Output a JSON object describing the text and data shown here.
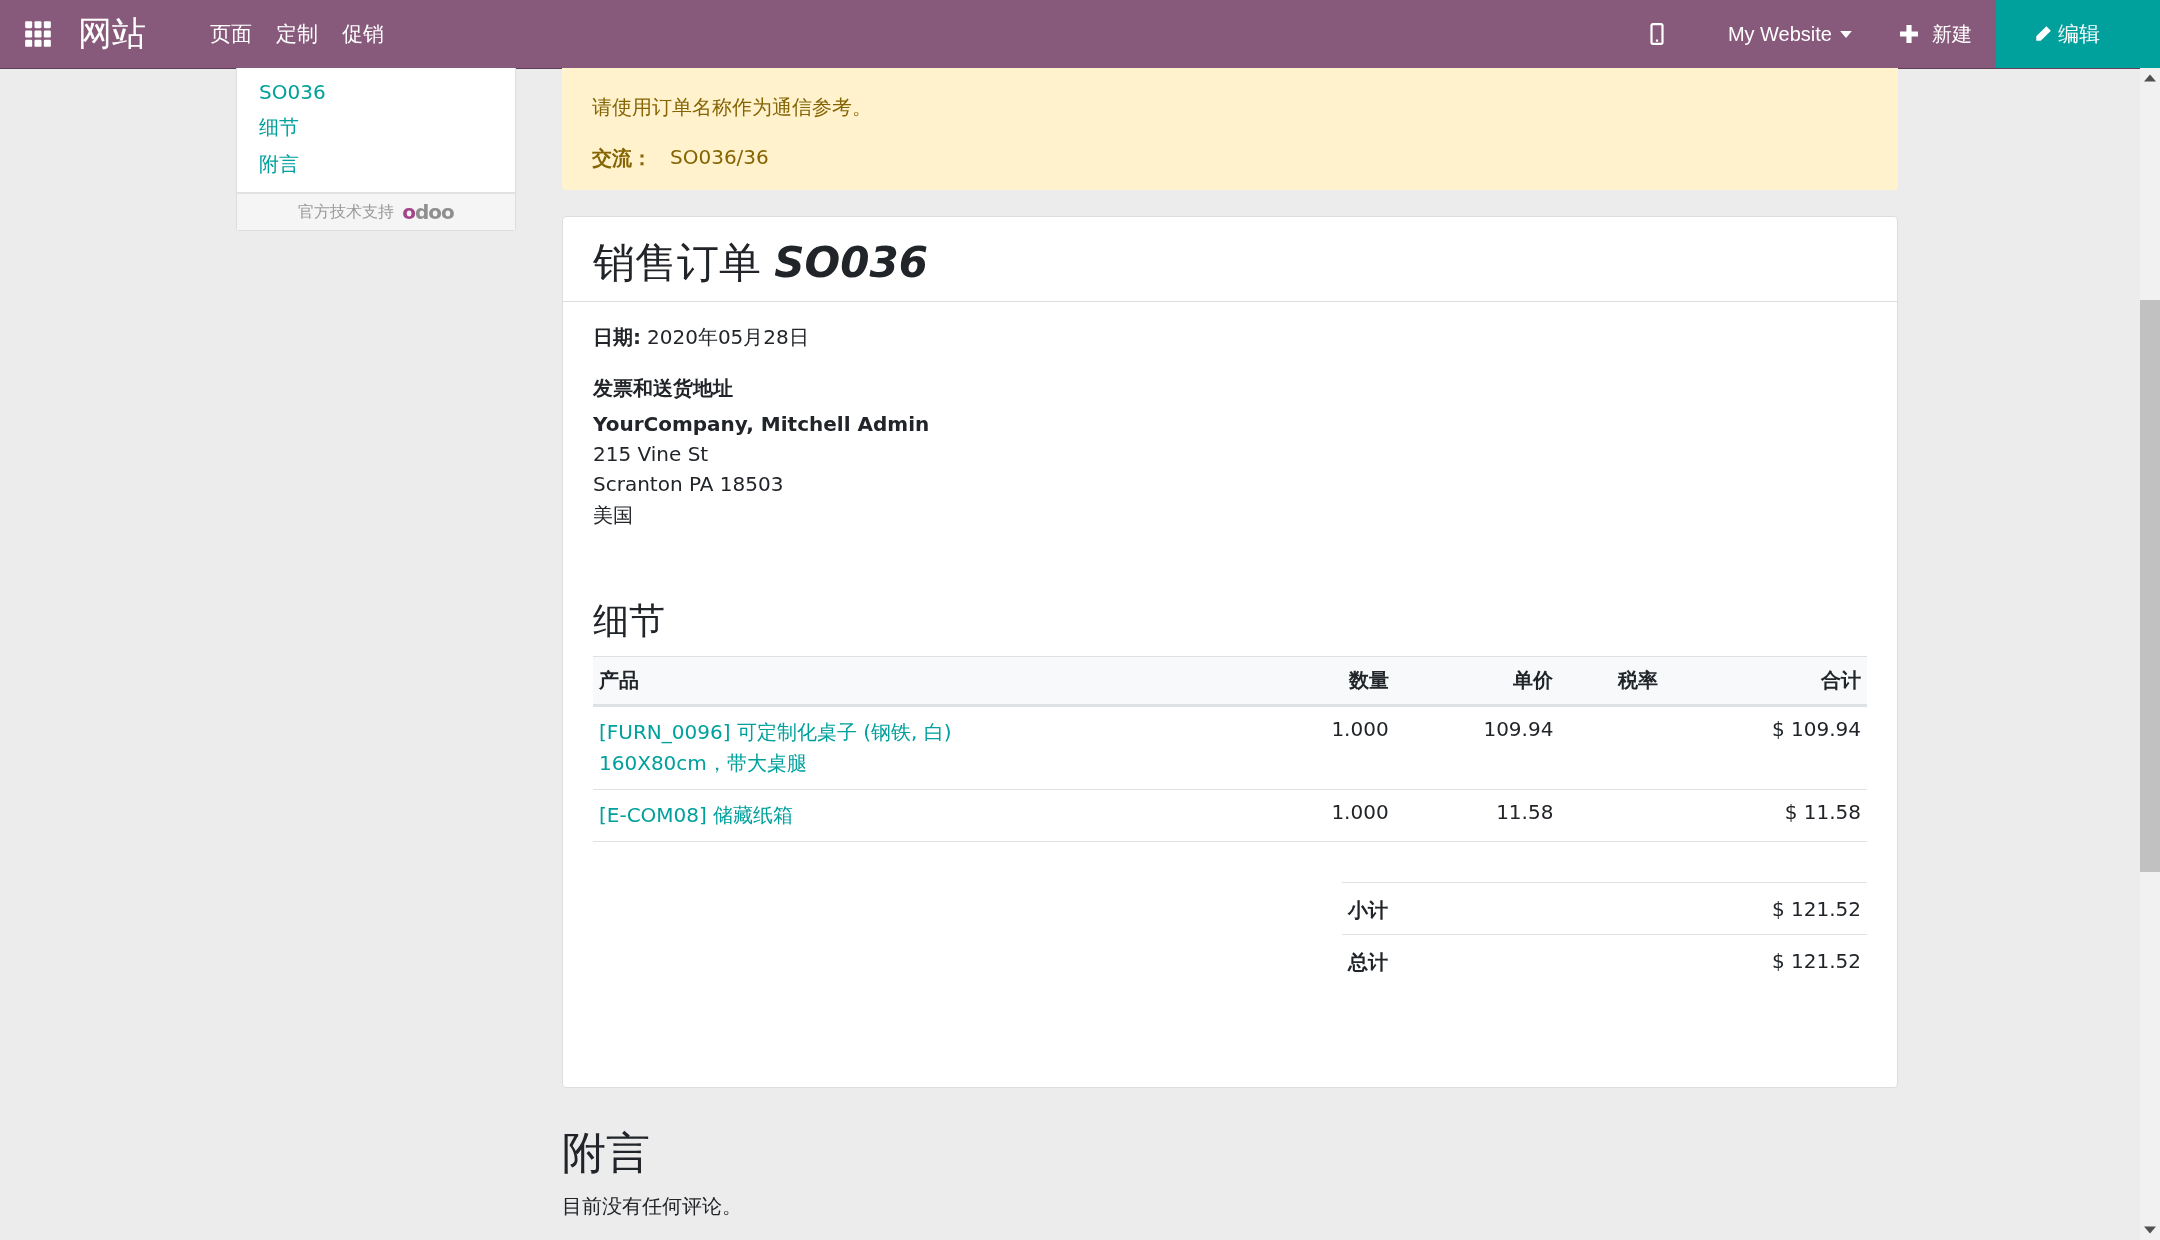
{
  "navbar": {
    "app_title": "网站",
    "menu": [
      {
        "label": "页面"
      },
      {
        "label": "定制"
      },
      {
        "label": "促销"
      }
    ],
    "website": "My Website",
    "new_button": "新建",
    "edit_button": "编辑"
  },
  "sidebar": {
    "items": [
      {
        "label": "SO036"
      },
      {
        "label": "细节"
      },
      {
        "label": "附言"
      }
    ],
    "footer": "官方技术支持",
    "footer_logo": "odoo"
  },
  "alert": {
    "message": "请使用订单名称作为通信参考。",
    "reference_label": "交流：",
    "reference_value": "SO036/36"
  },
  "order": {
    "title": "销售订单",
    "number": "SO036",
    "date_label": "日期:",
    "date": "2020年05月28日",
    "address_title": "发票和送货地址",
    "address_name": "YourCompany, Mitchell Admin",
    "address_lines": [
      "215 Vine St",
      "Scranton PA 18503",
      "美国"
    ]
  },
  "details": {
    "title": "细节",
    "columns": [
      "产品",
      "数量",
      "单价",
      "税率",
      "合计"
    ],
    "rows": [
      {
        "product": "[FURN_0096] 可定制化桌子 (钢铁, 白) 160X80cm，带大桌腿",
        "quantity": "1.000",
        "unit_price": "109.94",
        "tax": "",
        "total": "$ 109.94"
      },
      {
        "product": "[E-COM08] 储藏纸箱",
        "quantity": "1.000",
        "unit_price": "11.58",
        "tax": "",
        "total": "$ 11.58"
      }
    ],
    "totals": [
      {
        "label": "小计",
        "value": "$ 121.52"
      },
      {
        "label": "总计",
        "value": "$ 121.52"
      }
    ]
  },
  "comments": {
    "title": "附言",
    "text": "目前没有任何评论。"
  }
}
